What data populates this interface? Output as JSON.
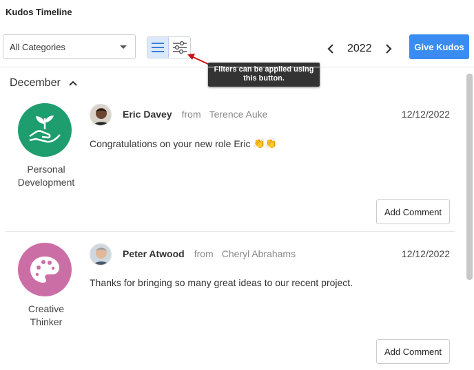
{
  "header": {
    "title": "Kudos Timeline"
  },
  "filters": {
    "category_value": "All Categories",
    "tooltip": "Filters can be applied using this button."
  },
  "icons": {
    "list_view": "list-icon",
    "filter": "sliders-icon",
    "prev_year": "chevron-left-icon",
    "next_year": "chevron-right-icon",
    "collapse": "chevron-up-icon"
  },
  "year_nav": {
    "year": "2022"
  },
  "actions": {
    "give_kudos": "Give Kudos"
  },
  "timeline": {
    "month": "December",
    "entries": [
      {
        "badge_label_1": "Personal",
        "badge_label_2": "Development",
        "badge_color": "#1e9e6e",
        "badge_icon": "plant-in-hand-icon",
        "recipient": "Eric Davey",
        "from_word": "from",
        "sender": "Terence Auke",
        "date": "12/12/2022",
        "message": "Congratulations on your new role Eric",
        "emoji": "👏👏",
        "comment_label": "Add Comment"
      },
      {
        "badge_label_1": "Creative",
        "badge_label_2": "Thinker",
        "badge_color": "#cc6ea6",
        "badge_icon": "palette-icon",
        "recipient": "Peter Atwood",
        "from_word": "from",
        "sender": "Cheryl Abrahams",
        "date": "12/12/2022",
        "message": "Thanks for bringing so many great ideas to our recent project.",
        "emoji": "",
        "comment_label": "Add Comment"
      }
    ]
  },
  "colors": {
    "accent": "#3b8cf0",
    "tooltip_bg": "#333333",
    "annotation_arrow": "#cc1111"
  }
}
